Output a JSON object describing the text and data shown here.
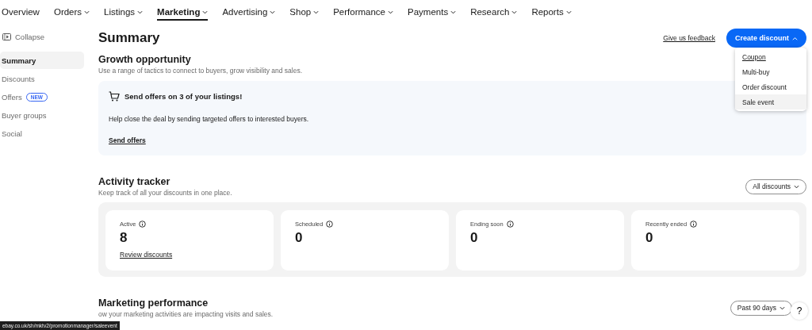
{
  "nav": [
    {
      "label": "Overview",
      "has_menu": false,
      "selected": false
    },
    {
      "label": "Orders",
      "has_menu": true,
      "selected": false
    },
    {
      "label": "Listings",
      "has_menu": true,
      "selected": false
    },
    {
      "label": "Marketing",
      "has_menu": true,
      "selected": true
    },
    {
      "label": "Advertising",
      "has_menu": true,
      "selected": false
    },
    {
      "label": "Shop",
      "has_menu": true,
      "selected": false
    },
    {
      "label": "Performance",
      "has_menu": true,
      "selected": false
    },
    {
      "label": "Payments",
      "has_menu": true,
      "selected": false
    },
    {
      "label": "Research",
      "has_menu": true,
      "selected": false
    },
    {
      "label": "Reports",
      "has_menu": true,
      "selected": false
    }
  ],
  "sidebar": {
    "collapse": "Collapse",
    "items": [
      {
        "label": "Summary",
        "selected": true
      },
      {
        "label": "Discounts",
        "selected": false
      },
      {
        "label": "Offers",
        "selected": false,
        "badge": "NEW"
      },
      {
        "label": "Buyer groups",
        "selected": false
      },
      {
        "label": "Social",
        "selected": false
      }
    ]
  },
  "header": {
    "title": "Summary",
    "feedback": "Give us feedback",
    "create_button": "Create discount",
    "menu_expanded": true,
    "menu": [
      {
        "label": "Coupon",
        "selected": false,
        "hovered": false,
        "underlined": true
      },
      {
        "label": "Multi-buy",
        "selected": false,
        "hovered": false,
        "underlined": false
      },
      {
        "label": "Order discount",
        "selected": false,
        "hovered": false,
        "underlined": false
      },
      {
        "label": "Sale event",
        "selected": false,
        "hovered": true,
        "underlined": false
      }
    ]
  },
  "growth": {
    "title": "Growth opportunity",
    "description": "Use a range of tactics to connect to buyers, grow visibility and sales.",
    "card_title": "Send offers on 3 of your listings!",
    "card_text": "Help close the deal by sending targeted offers to interested buyers.",
    "link": "Send offers"
  },
  "activity": {
    "title": "Activity tracker",
    "description": "Keep track of all your discounts in one place.",
    "filter": "All discounts",
    "stats": [
      {
        "label": "Active",
        "value": "8",
        "link": "Review discounts"
      },
      {
        "label": "Scheduled",
        "value": "0"
      },
      {
        "label": "Ending soon",
        "value": "0"
      },
      {
        "label": "Recently ended",
        "value": "0"
      }
    ]
  },
  "performance": {
    "title": "Marketing performance",
    "description": "ow your marketing activities are impacting visits and sales.",
    "filter": "Past 90 days"
  },
  "help_button": "?",
  "status_url": "ebay.co.uk/sh/mktv2/promotionmanager/saleevent"
}
